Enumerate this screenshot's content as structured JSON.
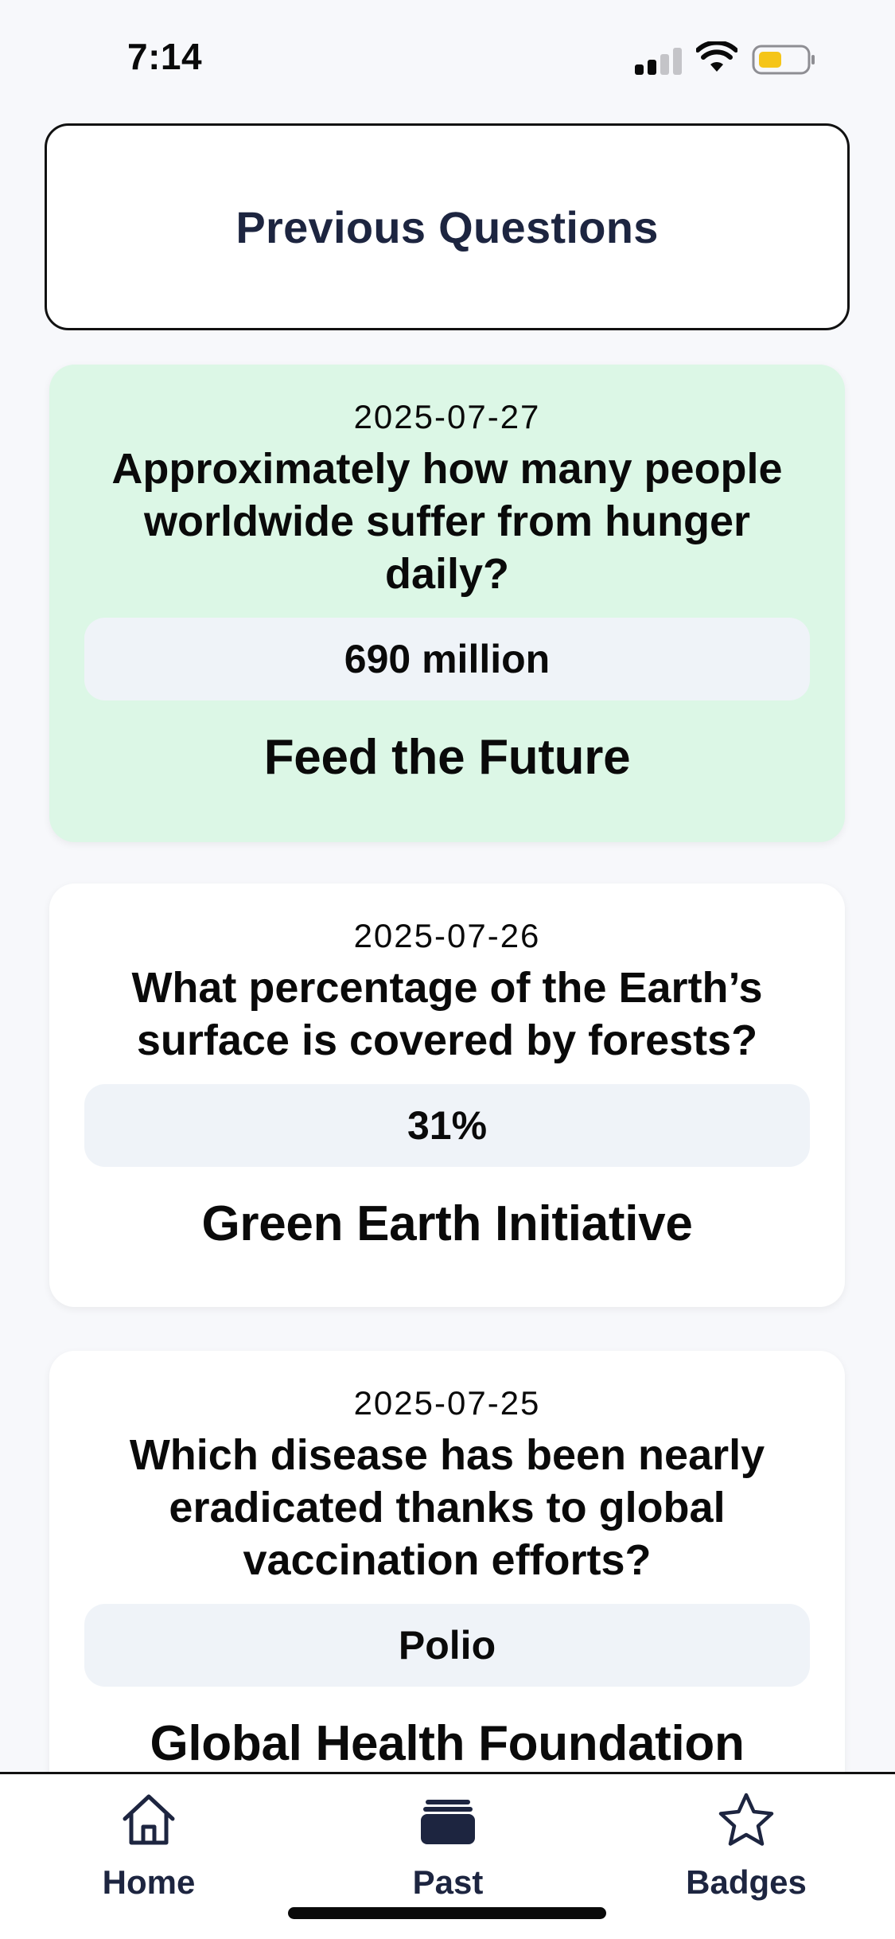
{
  "status_bar": {
    "time": "7:14",
    "battery_color": "#f5c518"
  },
  "header": {
    "title": "Previous Questions"
  },
  "questions": [
    {
      "date": "2025-07-27",
      "question": "Approximately how many people worldwide suffer from hunger daily?",
      "answer": "690 million",
      "organization": "Feed the Future",
      "highlighted": true
    },
    {
      "date": "2025-07-26",
      "question": "What percentage of the Earth’s surface is covered by forests?",
      "answer": "31%",
      "organization": "Green Earth Initiative",
      "highlighted": false
    },
    {
      "date": "2025-07-25",
      "question": "Which disease has been nearly eradicated thanks to global vaccination efforts?",
      "answer": "Polio",
      "organization": "Global Health Foundation",
      "highlighted": false
    }
  ],
  "tab_bar": {
    "tabs": [
      {
        "label": "Home",
        "icon": "house-icon",
        "active": false
      },
      {
        "label": "Past",
        "icon": "stack-icon",
        "active": true
      },
      {
        "label": "Badges",
        "icon": "star-icon",
        "active": false
      }
    ]
  },
  "colors": {
    "highlight_card": "#dcf7e6",
    "answer_pill": "#eff3f8",
    "title_navy": "#1d2540"
  }
}
